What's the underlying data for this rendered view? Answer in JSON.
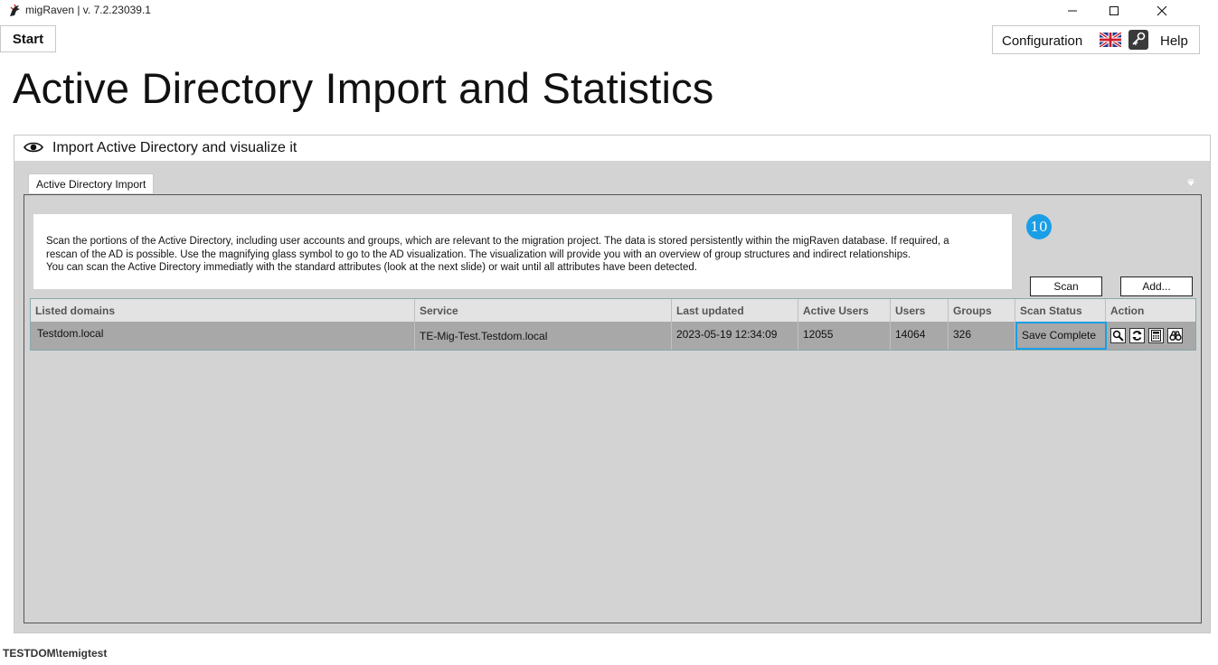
{
  "window": {
    "title": "migRaven | v. 7.2.23039.1",
    "minimize_icon": "minimize-icon",
    "maximize_icon": "maximize-icon",
    "close_icon": "close-icon"
  },
  "toolbar": {
    "start_label": "Start",
    "configuration_label": "Configuration",
    "help_label": "Help",
    "language_icon": "uk-flag-icon",
    "key_icon": "key-icon"
  },
  "page": {
    "title": "Active Directory Import and Statistics"
  },
  "expander": {
    "title": "Import Active Directory and visualize it",
    "icon": "eye-icon"
  },
  "tabs": [
    {
      "label": "Active Directory Import"
    }
  ],
  "description": {
    "lines": [
      "Scan the portions of the Active Directory, including user accounts and groups, which are relevant to the migration project. The data is stored persistently within the migRaven database. If required, a",
      "rescan of the AD is possible. Use the magnifying glass symbol to go to the AD visualization. The visualization will provide you with an overview of group structures and indirect relationships.",
      "You can scan the Active Directory immediatly with the standard attributes (look at the next slide) or wait until all attributes have been detected."
    ]
  },
  "buttons": {
    "scan_label": "Scan",
    "add_label": "Add..."
  },
  "table": {
    "columns": [
      "Listed domains",
      "Service",
      "Last updated",
      "Active Users",
      "Users",
      "Groups",
      "Scan Status",
      "Action"
    ],
    "rows": [
      {
        "domain": "Testdom.local",
        "service": "TE-Mig-Test.Testdom.local",
        "last_updated": "2023-05-19 12:34:09",
        "active_users": "12055",
        "users": "14064",
        "groups": "326",
        "scan_status": "Save Complete",
        "actions": [
          "search-icon",
          "refresh-icon",
          "calculator-icon",
          "binoculars-icon"
        ]
      }
    ]
  },
  "annotation": {
    "step": "10"
  },
  "status_bar": {
    "user": "TESTDOM\\temigtest"
  },
  "colors": {
    "highlight": "#1a9ee6",
    "panel_bg": "#d3d3d3",
    "selected_row": "#a8a8a8"
  }
}
